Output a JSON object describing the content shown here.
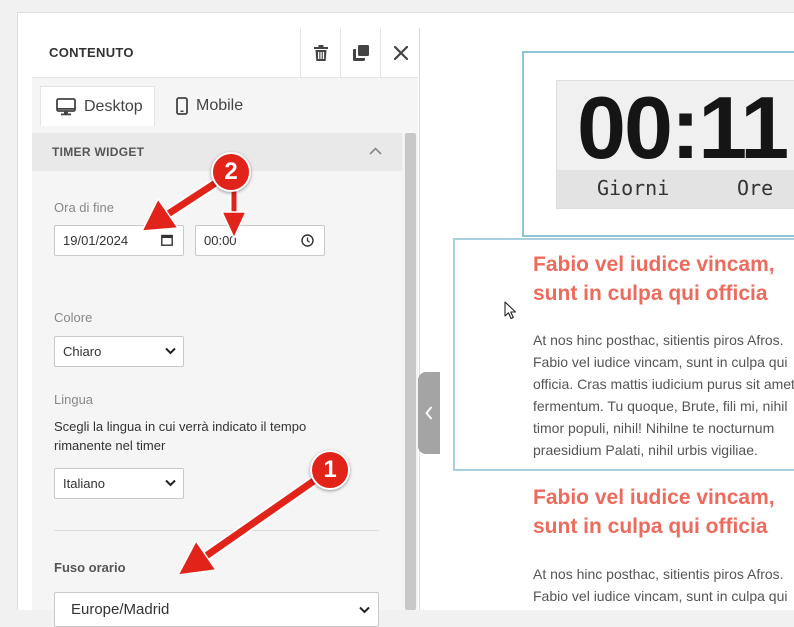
{
  "panel": {
    "title": "CONTENUTO",
    "tabs": [
      {
        "label": "Desktop",
        "icon": "monitor-icon",
        "active": true
      },
      {
        "label": "Mobile",
        "icon": "smartphone-icon",
        "active": false
      }
    ],
    "section": {
      "title": "TIMER WIDGET",
      "end_time": {
        "label": "Ora di fine",
        "date_value": "19/01/2024",
        "time_value": "00:00"
      },
      "color": {
        "label": "Colore",
        "value": "Chiaro"
      },
      "language": {
        "label": "Lingua",
        "description": "Scegli la lingua in cui verrà indicato il tempo rimanente nel timer",
        "value": "Italiano"
      },
      "timezone": {
        "label": "Fuso orario",
        "value": "Europe/Madrid"
      }
    }
  },
  "preview": {
    "timer": {
      "digits": "00:11",
      "units": [
        "Giorni",
        "Ore"
      ]
    },
    "blocks": [
      {
        "heading": [
          "Fabio vel iudice vincam,",
          "sunt in culpa qui officia"
        ],
        "body": [
          "At nos hinc posthac, sitientis piros Afros.",
          "Fabio vel iudice vincam, sunt in culpa qui",
          "officia. Cras mattis iudicium purus sit amet",
          "fermentum. Tu quoque, Brute, fili mi, nihil",
          "timor populi, nihil! Nihilne te nocturnum",
          "praesidium Palati, nihil urbis vigiliae."
        ]
      },
      {
        "heading": [
          "Fabio vel iudice vincam,",
          "sunt in culpa qui officia"
        ],
        "body": [
          "At nos hinc posthac, sitientis piros Afros.",
          "Fabio vel iudice vincam, sunt in culpa qui"
        ]
      }
    ]
  },
  "annotations": [
    {
      "number": "1"
    },
    {
      "number": "2"
    }
  ],
  "colors": {
    "heading": "#ec6b5c",
    "annotation": "#e2231a",
    "selection_border": "#8fc3d8"
  }
}
